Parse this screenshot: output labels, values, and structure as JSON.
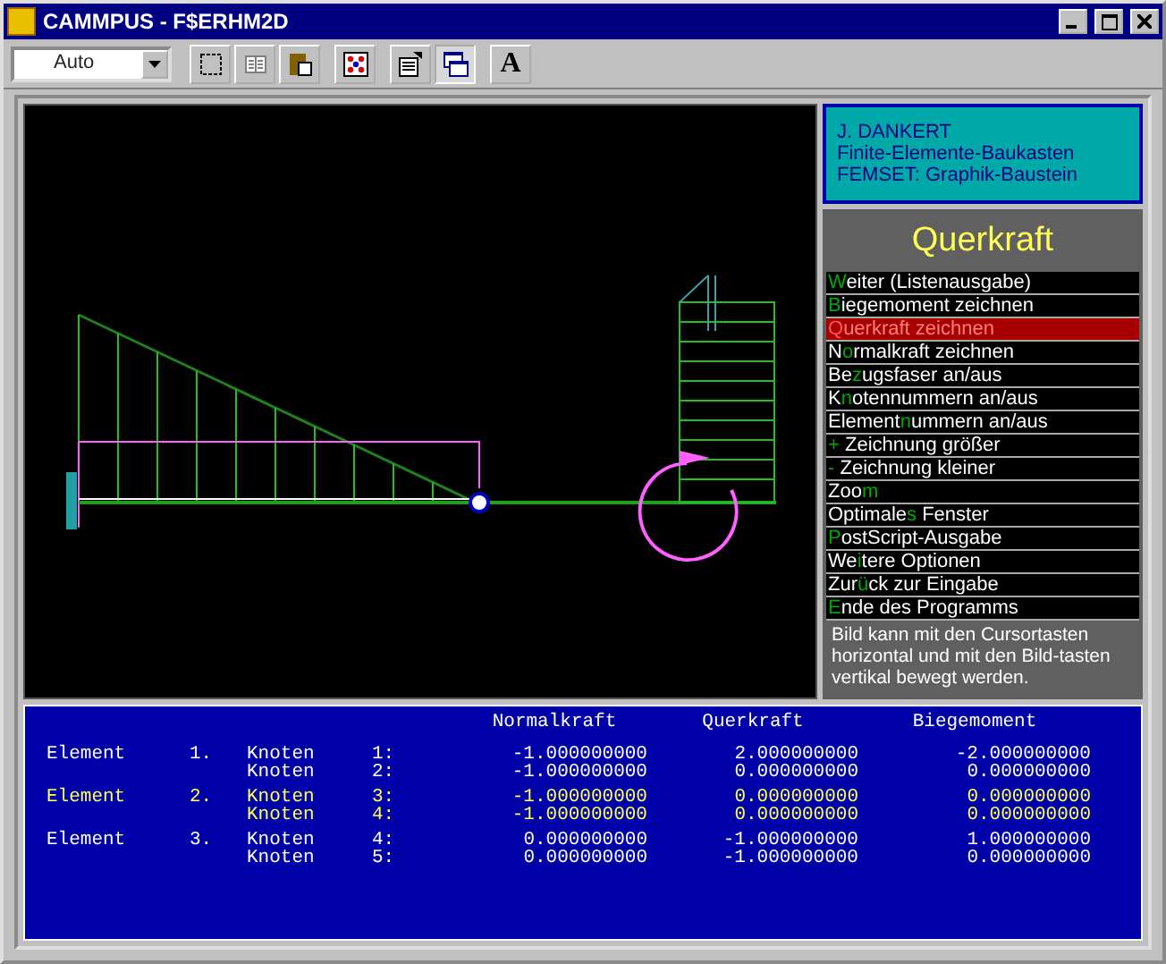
{
  "window": {
    "title": "CAMMPUS - F$ERHM2D"
  },
  "toolbar": {
    "zoom_select": {
      "value": "Auto"
    },
    "buttons": [
      {
        "kind": "select",
        "pressed": false
      },
      {
        "kind": "columns",
        "pressed": false
      },
      {
        "kind": "paste",
        "pressed": false
      },
      {
        "kind": "palette",
        "pressed": false
      },
      {
        "kind": "properties",
        "pressed": false
      },
      {
        "kind": "windows",
        "pressed": true
      },
      {
        "kind": "font",
        "pressed": false,
        "label": "A"
      }
    ]
  },
  "info_box": {
    "lines": [
      "J. DANKERT",
      "Finite-Elemente-Baukasten",
      "FEMSET:  Graphik-Baustein"
    ]
  },
  "menu": {
    "title": "Querkraft",
    "items": [
      {
        "key": "W",
        "after": "eiter (Listenausgabe)",
        "selected": false
      },
      {
        "key": "B",
        "after": "iegemoment zeichnen",
        "selected": false
      },
      {
        "key": "Q",
        "after": "uerkraft zeichnen",
        "selected": true
      },
      {
        "before": "N",
        "key": "o",
        "after": "rmalkraft zeichnen",
        "selected": false
      },
      {
        "before": "Be",
        "key": "z",
        "after": "ugsfaser an/aus",
        "selected": false
      },
      {
        "before": "K",
        "key": "n",
        "after": "otennummern  an/aus",
        "selected": false
      },
      {
        "before": "Element",
        "key": "n",
        "after": "ummern an/aus",
        "selected": false
      },
      {
        "key": "+",
        "after": " Zeichnung größer",
        "selected": false
      },
      {
        "key": "-",
        "after": " Zeichnung kleiner",
        "selected": false
      },
      {
        "before": "Zoo",
        "key": "m",
        "selected": false
      },
      {
        "before": "Optimale",
        "key": "s",
        "after": " Fenster",
        "selected": false
      },
      {
        "key": "P",
        "after": "ostScript-Ausgabe",
        "selected": false
      },
      {
        "before": "We",
        "key": "i",
        "after": "tere Optionen",
        "selected": false
      },
      {
        "before": "Zur",
        "key": "ü",
        "after": "ck zur Eingabe",
        "selected": false
      },
      {
        "key": "E",
        "after": "nde des Programms",
        "selected": false
      }
    ],
    "hint": "Bild kann mit den Cursortasten horizontal und mit den Bild-tasten vertikal bewegt werden."
  },
  "results": {
    "columns": [
      "Normalkraft",
      "Querkraft",
      "Biegemoment"
    ],
    "elements": [
      {
        "label": "Element",
        "number": "1.",
        "highlighted": false,
        "nodes": [
          {
            "label": "Knoten",
            "number": "1:",
            "values": [
              "-1.000000000",
              "2.000000000",
              "-2.000000000"
            ]
          },
          {
            "label": "Knoten",
            "number": "2:",
            "values": [
              "-1.000000000",
              "0.000000000",
              "0.000000000"
            ]
          }
        ]
      },
      {
        "label": "Element",
        "number": "2.",
        "highlighted": true,
        "nodes": [
          {
            "label": "Knoten",
            "number": "3:",
            "values": [
              "-1.000000000",
              "0.000000000",
              "0.000000000"
            ]
          },
          {
            "label": "Knoten",
            "number": "4:",
            "values": [
              "-1.000000000",
              "0.000000000",
              "0.000000000"
            ]
          }
        ]
      },
      {
        "label": "Element",
        "number": "3.",
        "highlighted": false,
        "nodes": [
          {
            "label": "Knoten",
            "number": "4:",
            "values": [
              "0.000000000",
              "-1.000000000",
              "1.000000000"
            ]
          },
          {
            "label": "Knoten",
            "number": "5:",
            "values": [
              "0.000000000",
              "-1.000000000",
              "0.000000000"
            ]
          }
        ]
      }
    ]
  }
}
